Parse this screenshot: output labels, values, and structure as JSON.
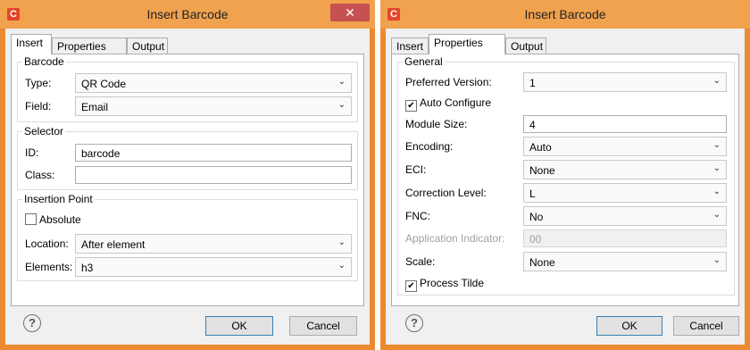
{
  "accent_color": "#eb8a2e",
  "left_dialog": {
    "app_icon": "C",
    "title": "Insert Barcode",
    "close_glyph": "✕",
    "tabs": [
      "Insert",
      "Properties",
      "Output"
    ],
    "active_tab": "Insert",
    "barcode": {
      "group_title": "Barcode",
      "type_label": "Type:",
      "type_value": "QR Code",
      "field_label": "Field:",
      "field_value": "Email"
    },
    "selector": {
      "group_title": "Selector",
      "id_label": "ID:",
      "id_value": "barcode",
      "class_label": "Class:",
      "class_value": ""
    },
    "insertion_point": {
      "group_title": "Insertion Point",
      "absolute_label": "Absolute",
      "absolute_checked": false,
      "location_label": "Location:",
      "location_value": "After element",
      "elements_label": "Elements:",
      "elements_value": "h3"
    },
    "help_glyph": "?",
    "ok_label": "OK",
    "cancel_label": "Cancel"
  },
  "right_dialog": {
    "app_icon": "C",
    "title": "Insert Barcode",
    "tabs": [
      "Insert",
      "Properties",
      "Output"
    ],
    "active_tab": "Properties",
    "general": {
      "group_title": "General",
      "preferred_version_label": "Preferred Version:",
      "preferred_version_value": "1",
      "auto_configure_label": "Auto Configure",
      "auto_configure_checked": true,
      "module_size_label": "Module Size:",
      "module_size_value": "4",
      "encoding_label": "Encoding:",
      "encoding_value": "Auto",
      "eci_label": "ECI:",
      "eci_value": "None",
      "correction_level_label": "Correction Level:",
      "correction_level_value": "L",
      "fnc_label": "FNC:",
      "fnc_value": "No",
      "app_indicator_label": "Application Indicator:",
      "app_indicator_value": "00",
      "scale_label": "Scale:",
      "scale_value": "None",
      "process_tilde_label": "Process Tilde",
      "process_tilde_checked": true
    },
    "help_glyph": "?",
    "ok_label": "OK",
    "cancel_label": "Cancel"
  }
}
